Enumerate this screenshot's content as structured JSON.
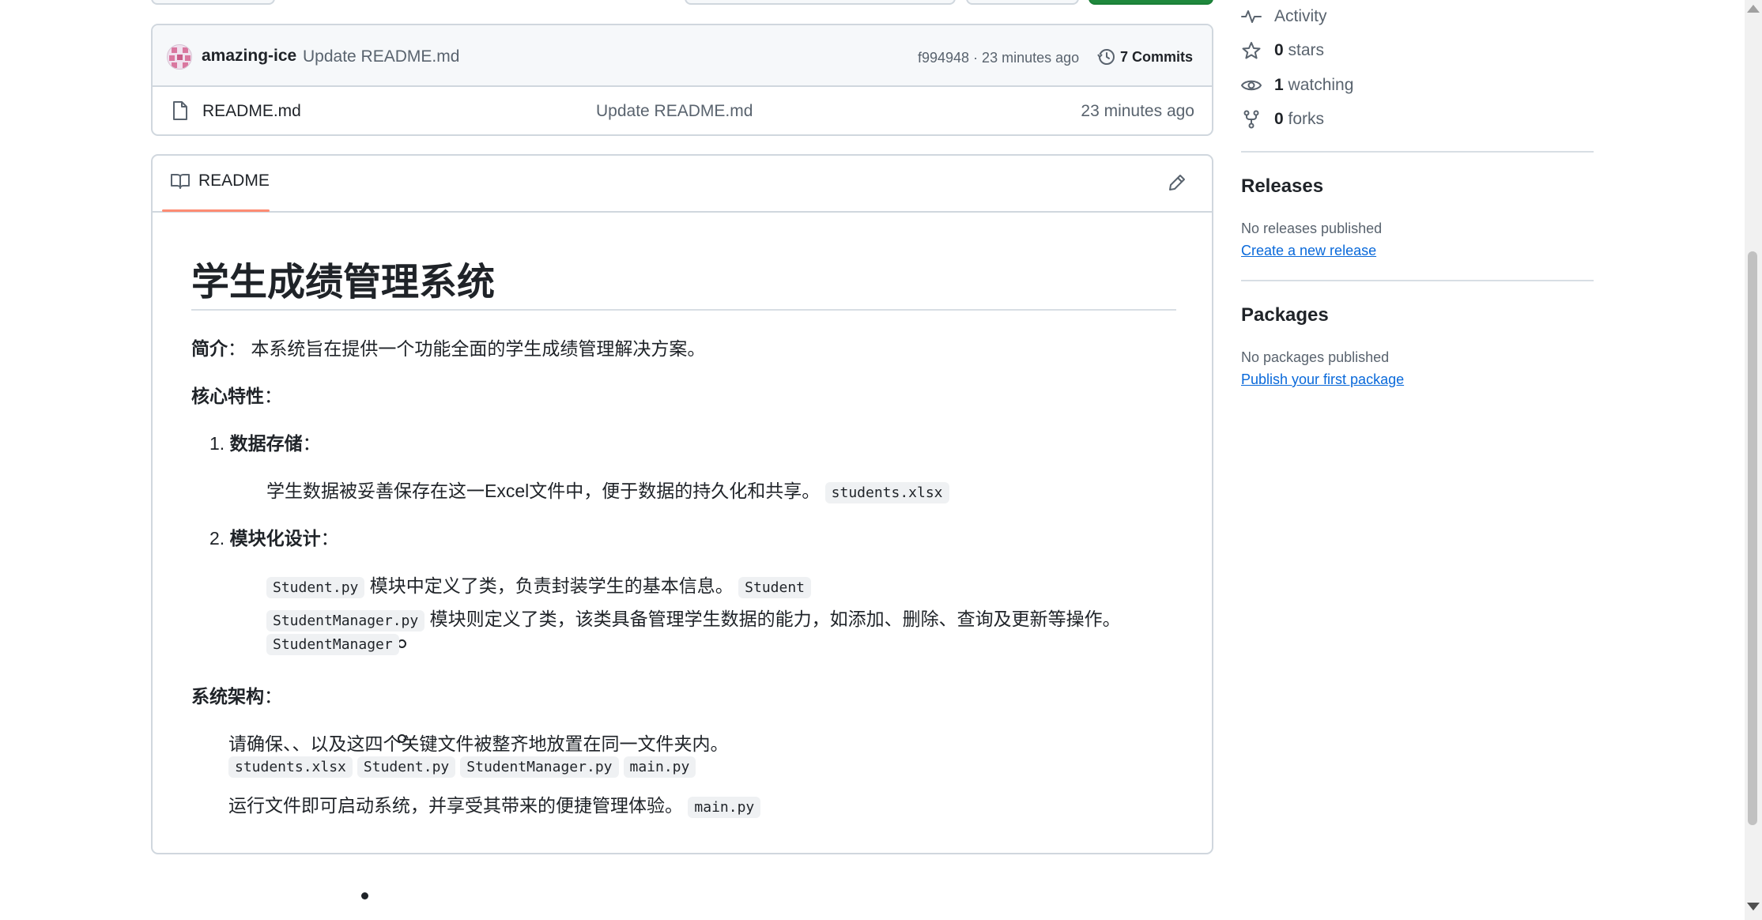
{
  "commit": {
    "user": "amazing-ice",
    "message": "Update README.md",
    "hash_time": "f994948 · 23 minutes ago",
    "count": "7 Commits"
  },
  "files": [
    {
      "name": "README.md",
      "message": "Update README.md",
      "time": "23 minutes ago"
    }
  ],
  "readme": {
    "tab_label": "README",
    "title": "学生成绩管理系统",
    "intro_label": "简介",
    "intro_colon": "：",
    "intro_text": "本系统旨在提供一个功能全面的学生成绩管理解决方案。",
    "features_label": "核心特性",
    "colon": "：",
    "item1_num": "1.",
    "item1_label": "数据存储",
    "item1_sub_text": "学生数据被妥善保存在这一Excel文件中，便于数据的持久化和共享。",
    "item1_sub_code": "students.xlsx",
    "item2_num": "2.",
    "item2_label": "模块化设计",
    "item2_sub1_code_a": "Student.py",
    "item2_sub1_text": "模块中定义了类，负责封装学生的基本信息。",
    "item2_sub1_code_b": "Student",
    "item2_sub2_code_a": "StudentManager.py",
    "item2_sub2_text": "模块则定义了类，该类具备管理学生数据的能力，如添加、删除、查询及更新等操作。",
    "item2_sub2_code_b": "StudentManager",
    "arch_label": "系统架构",
    "arch_item1_text": "请确保、、以及这四个关键文件被整齐地放置在同一文件夹内。",
    "arch_item1_codes": [
      "students.xlsx",
      "Student.py",
      "StudentManager.py",
      "main.py"
    ],
    "arch_item2_text": "运行文件即可启动系统，并享受其带来的便捷管理体验。",
    "arch_item2_code": "main.py"
  },
  "sidebar": {
    "activity": "Activity",
    "stars_count": "0",
    "stars_label": "stars",
    "watching_count": "1",
    "watching_label": "watching",
    "forks_count": "0",
    "forks_label": "forks",
    "releases_heading": "Releases",
    "releases_note": "No releases published",
    "releases_link": "Create a new release",
    "packages_heading": "Packages",
    "packages_note": "No packages published",
    "packages_link": "Publish your first package"
  },
  "icons": {
    "history": "history-icon",
    "file": "file-icon",
    "book": "book-icon",
    "pencil": "pencil-icon",
    "activity": "pulse-icon",
    "star": "star-icon",
    "eye": "eye-icon",
    "fork": "fork-icon"
  },
  "colors": {
    "link": "#0969da",
    "tab_underline": "#fd8c73",
    "primary_button": "#1f883d"
  }
}
